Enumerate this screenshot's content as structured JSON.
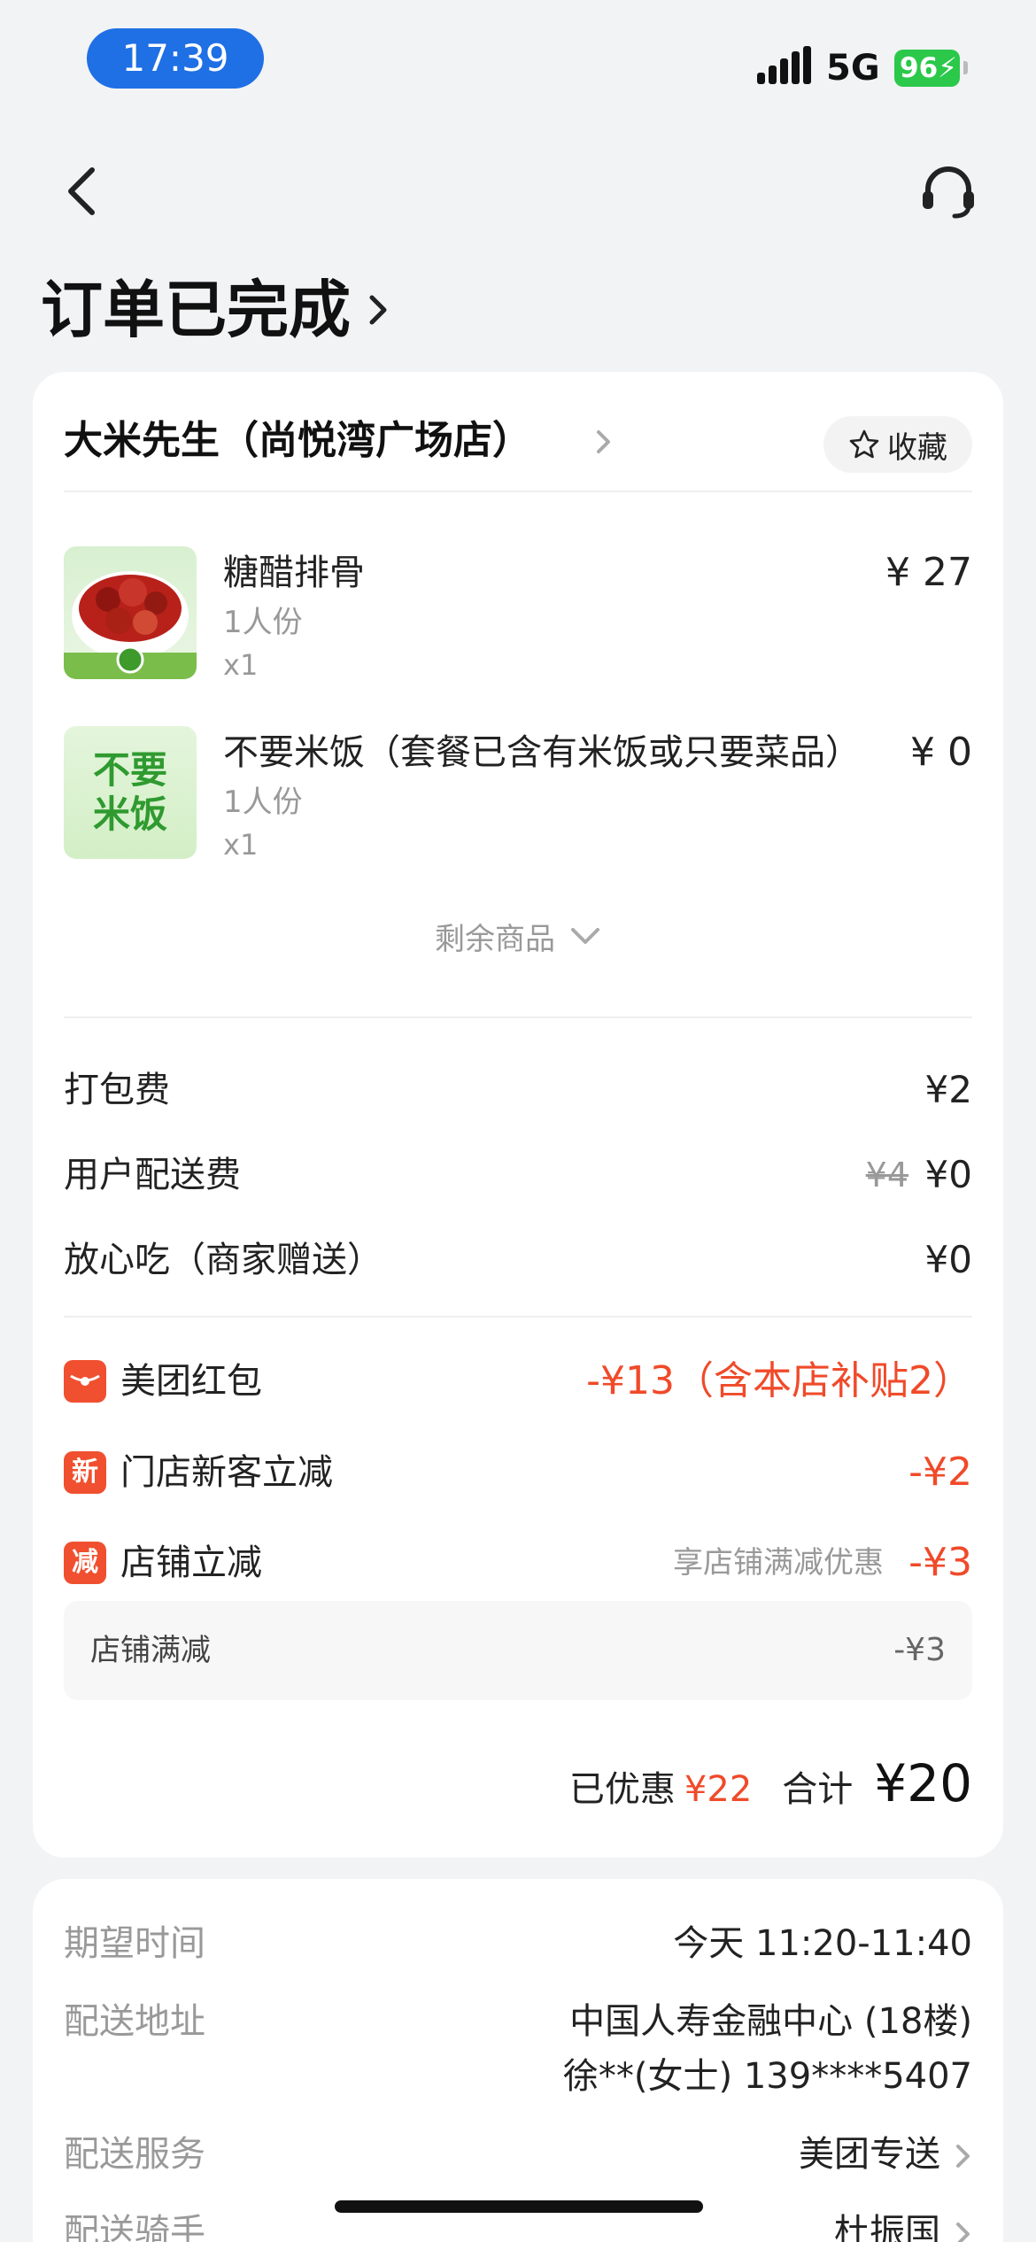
{
  "status_bar": {
    "time": "17:39",
    "network": "5G",
    "battery": "96"
  },
  "header": {
    "title": "订单已完成"
  },
  "store": {
    "name": "大米先生（尚悦湾广场店）",
    "favorite_label": "收藏"
  },
  "items": [
    {
      "name": "糖醋排骨",
      "portion": "1人份",
      "qty": "x1",
      "price": "¥ 27",
      "thumb_text": ""
    },
    {
      "name": "不要米饭（套餐已含有米饭或只要菜品）",
      "portion": "1人份",
      "qty": "x1",
      "price": "¥ 0",
      "thumb_text_line1": "不要",
      "thumb_text_line2": "米饭"
    }
  ],
  "more_items_label": "剩余商品",
  "fees": {
    "packing": {
      "label": "打包费",
      "value": "¥2"
    },
    "delivery": {
      "label": "用户配送费",
      "original": "¥4",
      "value": "¥0"
    },
    "insurance": {
      "label": "放心吃（商家赠送）",
      "value": "¥0"
    }
  },
  "discounts": {
    "red_packet": {
      "label": "美团红包",
      "value": "-¥13（含本店补贴2）"
    },
    "new_customer": {
      "icon_text": "新",
      "label": "门店新客立减",
      "value": "-¥2"
    },
    "store_discount": {
      "icon_text": "减",
      "label": "店铺立减",
      "note": "享店铺满减优惠",
      "value": "-¥3"
    },
    "sub": {
      "label": "店铺满减",
      "value": "-¥3"
    }
  },
  "totals": {
    "saved_label": "已优惠",
    "saved_value": "¥22",
    "sum_label": "合计",
    "sum_value": "¥20"
  },
  "info": {
    "expected_time": {
      "label": "期望时间",
      "value": "今天 11:20-11:40"
    },
    "address": {
      "label": "配送地址",
      "line1": "中国人寿金融中心 (18楼)",
      "line2": "徐**(女士) 139****5407"
    },
    "service": {
      "label": "配送服务",
      "value": "美团专送"
    },
    "rider": {
      "label": "配送骑手",
      "value": "杜振国"
    }
  },
  "colors": {
    "accent_red": "#f04a2a",
    "time_pill": "#1f6fe5",
    "battery": "#2bc84a"
  }
}
